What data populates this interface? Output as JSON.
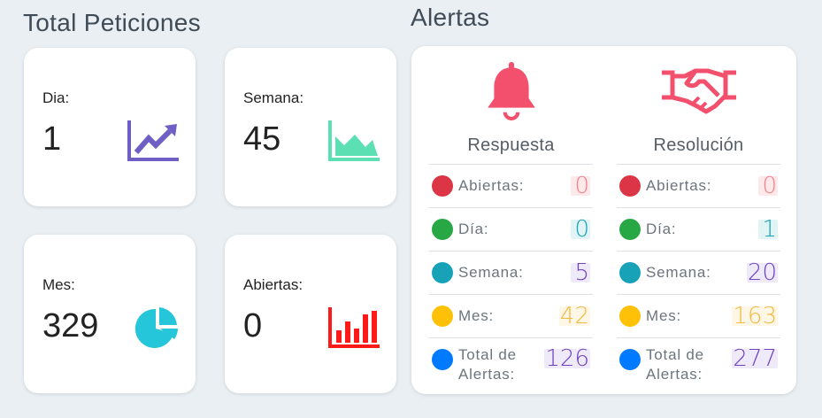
{
  "total": {
    "title": "Total Peticiones",
    "cards": [
      {
        "label": "Dia:",
        "value": "1",
        "icon": "line-chart-icon",
        "color": "#6f5fc5"
      },
      {
        "label": "Semana:",
        "value": "45",
        "icon": "area-chart-icon",
        "color": "#5ddfb4"
      },
      {
        "label": "Mes:",
        "value": "329",
        "icon": "pie-chart-icon",
        "color": "#26c6da"
      },
      {
        "label": "Abiertas:",
        "value": "0",
        "icon": "bar-chart-icon",
        "color": "#ff1a1a"
      }
    ]
  },
  "alerts": {
    "title": "Alertas",
    "columns": [
      {
        "title": "Respuesta",
        "icon": "bell-icon",
        "rows": [
          {
            "label": "Abiertas:",
            "value": "0",
            "color": "#dc3545"
          },
          {
            "label": "Día:",
            "value": "0",
            "color": "#28a745"
          },
          {
            "label": "Semana:",
            "value": "5",
            "color": "#17a2b8"
          },
          {
            "label": "Mes:",
            "value": "42",
            "color": "#ffc107"
          },
          {
            "label": "Total de Alertas:",
            "value": "126",
            "color": "#007bff"
          }
        ]
      },
      {
        "title": "Resolución",
        "icon": "handshake-icon",
        "rows": [
          {
            "label": "Abiertas:",
            "value": "0",
            "color": "#dc3545"
          },
          {
            "label": "Día:",
            "value": "1",
            "color": "#28a745"
          },
          {
            "label": "Semana:",
            "value": "20",
            "color": "#17a2b8"
          },
          {
            "label": "Mes:",
            "value": "163",
            "color": "#ffc107"
          },
          {
            "label": "Total de Alertas:",
            "value": "277",
            "color": "#007bff"
          }
        ]
      }
    ],
    "accent": "#f2506c"
  }
}
